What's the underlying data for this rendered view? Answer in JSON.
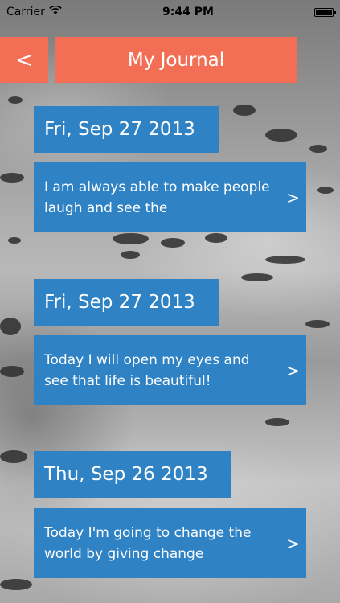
{
  "status_bar": {
    "carrier": "Carrier",
    "time": "9:44 PM",
    "icons": [
      "wifi-icon",
      "battery-icon"
    ]
  },
  "nav": {
    "back_label": "<",
    "title": "My Journal"
  },
  "entries": [
    {
      "date": "Fri, Sep 27 2013",
      "text": "I am always able to make people laugh and see the",
      "chevron": ">"
    },
    {
      "date": "Fri, Sep 27 2013",
      "text": "Today I will open my eyes and see that life is beautiful!",
      "chevron": ">"
    },
    {
      "date": "Thu, Sep 26 2013",
      "text": "Today I'm going to change the world by giving change",
      "chevron": ">"
    }
  ],
  "colors": {
    "accent_orange": "#f26e55",
    "card_blue": "#2f82c4",
    "text_white": "#ffffff"
  }
}
